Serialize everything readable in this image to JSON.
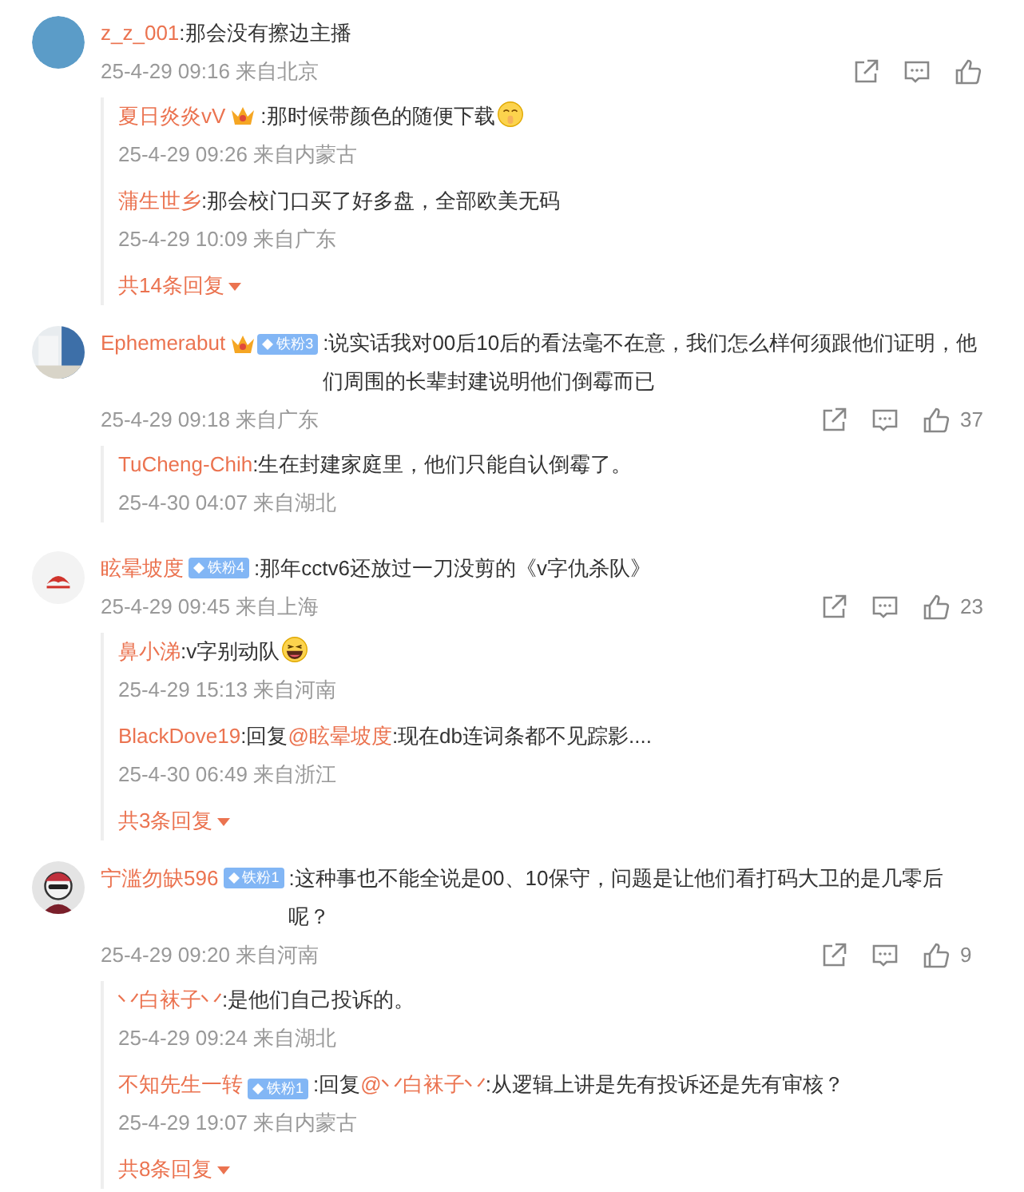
{
  "comments": [
    {
      "avatar": {
        "kind": "plain"
      },
      "name": "z_z_001",
      "text": ":那会没有擦边主播",
      "time": "25-4-29 09:16 来自北京",
      "replies": [
        {
          "name": "夏日炎炎vV",
          "badge": {
            "crown": true
          },
          "text": ":那时候带颜色的随便下载",
          "emoji": {
            "kind": "shush"
          },
          "time": "25-4-29 09:26 来自内蒙古"
        },
        {
          "name": "蒲生世乡",
          "text": ":那会校门口买了好多盘，全部欧美无码",
          "time": "25-4-29 10:09 来自广东"
        }
      ],
      "more": "共14条回复"
    },
    {
      "avatar": {
        "kind": "photo"
      },
      "name": "Ephemerabut",
      "badge": {
        "crown": true,
        "label": "铁粉3"
      },
      "text": ":说实话我对00后10后的看法毫不在意，我们怎么样何须跟他们证明，他们周围的长辈封建说明他们倒霉而已",
      "time": "25-4-29 09:18 来自广东",
      "likes": "37",
      "replies": [
        {
          "name": "TuCheng-Chih",
          "text": ":生在封建家庭里，他们只能自认倒霉了。",
          "time": "25-4-30 04:07 来自湖北"
        }
      ]
    },
    {
      "avatar": {
        "kind": "logo"
      },
      "name": "眩晕坡度",
      "badge": {
        "crown": false,
        "label": "铁粉4"
      },
      "text": ":那年cctv6还放过一刀没剪的《v字仇杀队》",
      "time": "25-4-29 09:45 来自上海",
      "likes": "23",
      "replies": [
        {
          "name": "鼻小涕",
          "text": ":v字别动队",
          "emoji": {
            "kind": "laugh"
          },
          "time": "25-4-29 15:13 来自河南"
        },
        {
          "name": "BlackDove19",
          "prefix": ":回复",
          "mention": "@眩晕坡度",
          "text": ":现在db连词条都不见踪影....",
          "time": "25-4-30 06:49 来自浙江"
        }
      ],
      "more": "共3条回复"
    },
    {
      "avatar": {
        "kind": "figure"
      },
      "name": "宁滥勿缺596",
      "badge": {
        "crown": false,
        "label": "铁粉1"
      },
      "text": ":这种事也不能全说是00、10保守，问题是让他们看打码大卫的是几零后呢？",
      "time": "25-4-29 09:20 来自河南",
      "likes": "9",
      "replies": [
        {
          "name": "丷白袜子丷",
          "text": ":是他们自己投诉的。",
          "time": "25-4-29 09:24 来自湖北"
        },
        {
          "name": "不知先生一转",
          "badge": {
            "crown": false,
            "label": "铁粉1"
          },
          "prefix": ":回复",
          "mention": "@丷白袜子丷",
          "text": ":从逻辑上讲是先有投诉还是先有审核？",
          "time": "25-4-29 19:07 来自内蒙古"
        }
      ],
      "more": "共8条回复"
    }
  ]
}
